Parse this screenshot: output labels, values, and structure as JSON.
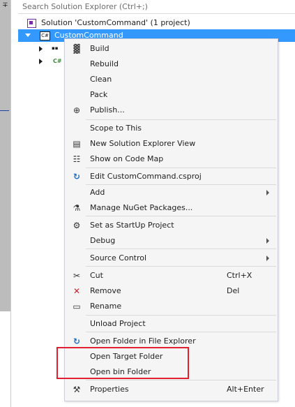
{
  "search": {
    "placeholder": "Search Solution Explorer (Ctrl+;)"
  },
  "tree": {
    "solution_label": "Solution 'CustomCommand' (1 project)",
    "project_label": "CustomCommand",
    "project_icon_text": "C#",
    "child1_icon_text": "▪▪",
    "child2_icon_text": "C#"
  },
  "menu": {
    "items": [
      {
        "label": "Build",
        "icon": "build-icon",
        "glyph": "▓"
      },
      {
        "label": "Rebuild"
      },
      {
        "label": "Clean"
      },
      {
        "label": "Pack"
      },
      {
        "label": "Publish...",
        "icon": "globe-icon",
        "glyph": "⊕"
      },
      {
        "label": "Scope to This"
      },
      {
        "label": "New Solution Explorer View",
        "icon": "new-view-icon",
        "glyph": "▤"
      },
      {
        "label": "Show on Code Map",
        "icon": "code-map-icon",
        "glyph": "☷"
      },
      {
        "label": "Edit CustomCommand.csproj",
        "icon": "refresh-icon",
        "glyph": "↻"
      },
      {
        "label": "Add"
      },
      {
        "label": "Manage NuGet Packages...",
        "icon": "nuget-icon",
        "glyph": "⚗"
      },
      {
        "label": "Set as StartUp Project",
        "icon": "gear-icon",
        "glyph": "⚙"
      },
      {
        "label": "Debug"
      },
      {
        "label": "Source Control"
      },
      {
        "label": "Cut",
        "icon": "scissors-icon",
        "glyph": "✂",
        "shortcut": "Ctrl+X"
      },
      {
        "label": "Remove",
        "icon": "remove-icon",
        "glyph": "✕",
        "shortcut": "Del"
      },
      {
        "label": "Rename",
        "icon": "rename-icon",
        "glyph": "▭"
      },
      {
        "label": "Unload Project"
      },
      {
        "label": "Open Folder in File Explorer",
        "icon": "refresh-icon",
        "glyph": "↻"
      },
      {
        "label": "Open Target Folder"
      },
      {
        "label": "Open bin Folder"
      },
      {
        "label": "Properties",
        "icon": "wrench-icon",
        "glyph": "⚒",
        "shortcut": "Alt+Enter"
      }
    ]
  },
  "colors": {
    "selection": "#3399ff",
    "highlight_box": "#e0202f",
    "remove_icon": "#d21f2b",
    "blue_icon": "#1e6fc9"
  }
}
